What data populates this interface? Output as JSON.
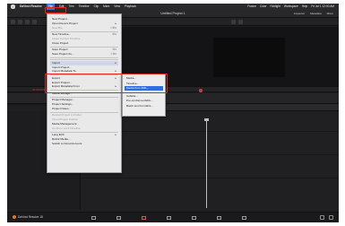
{
  "menubar": {
    "app_name": "DaVinci Resolve",
    "items": [
      "File",
      "Edit",
      "Trim",
      "Timeline",
      "Clip",
      "Mark",
      "View",
      "Playback"
    ],
    "active": "File",
    "right_items": [
      "Fusion",
      "Color",
      "Fairlight",
      "Workspace",
      "Help",
      "Fri Jul 1 12:00 AM"
    ]
  },
  "titlebar": {
    "project_title": "Untitled Project 1",
    "right_buttons": [
      "Inspector",
      "Metadata",
      "Mixer"
    ]
  },
  "file_menu": {
    "items": [
      {
        "label": "New Project...",
        "shortcut": "",
        "disabled": false,
        "submenu": false
      },
      {
        "label": "Open Recent Project",
        "shortcut": "",
        "disabled": false,
        "submenu": true
      },
      {
        "label": "New Bin",
        "shortcut": "⇧⌘N",
        "disabled": true,
        "submenu": false
      },
      {
        "label": "",
        "separator": true
      },
      {
        "label": "New Timeline...",
        "shortcut": "⌘N",
        "disabled": false,
        "submenu": false
      },
      {
        "label": "Close Current Timeline",
        "shortcut": "",
        "disabled": true,
        "submenu": false
      },
      {
        "label": "Close Project",
        "shortcut": "",
        "disabled": false,
        "submenu": false
      },
      {
        "label": "",
        "separator": true
      },
      {
        "label": "Save Project",
        "shortcut": "⌘S",
        "disabled": false,
        "submenu": false
      },
      {
        "label": "Save Project As...",
        "shortcut": "⇧⌘S",
        "disabled": false,
        "submenu": false
      },
      {
        "label": "",
        "separator": true
      },
      {
        "label": "",
        "separator": true
      },
      {
        "label": "Import",
        "shortcut": "",
        "disabled": false,
        "submenu": true,
        "highlight": true
      },
      {
        "label": "Import Project...",
        "shortcut": "",
        "disabled": false,
        "submenu": false
      },
      {
        "label": "Import Metadata To",
        "shortcut": "",
        "disabled": false,
        "submenu": true
      },
      {
        "label": "",
        "separator": true
      },
      {
        "label": "Export",
        "shortcut": "",
        "disabled": false,
        "submenu": true
      },
      {
        "label": "Export Project...",
        "shortcut": "",
        "disabled": false,
        "submenu": false
      },
      {
        "label": "Export Metadata From",
        "shortcut": "",
        "disabled": false,
        "submenu": true
      },
      {
        "label": "",
        "separator": true
      },
      {
        "label": "Media Storage...",
        "shortcut": "",
        "disabled": false,
        "submenu": false
      },
      {
        "label": "",
        "separator": true
      },
      {
        "label": "Project Manager...",
        "shortcut": "",
        "disabled": false,
        "submenu": false
      },
      {
        "label": "Project Settings...",
        "shortcut": "",
        "disabled": false,
        "submenu": false
      },
      {
        "label": "Project Notes...",
        "shortcut": "",
        "disabled": false,
        "submenu": false
      },
      {
        "label": "",
        "separator": true
      },
      {
        "label": "Reveal Project in Finder",
        "shortcut": "",
        "disabled": true,
        "submenu": false
      },
      {
        "label": "Open Project Archive",
        "shortcut": "",
        "disabled": true,
        "submenu": false
      },
      {
        "label": "Media Management...",
        "shortcut": "",
        "disabled": false,
        "submenu": false
      },
      {
        "label": "Conform Lock Timeline",
        "shortcut": "",
        "disabled": true,
        "submenu": false
      },
      {
        "label": "",
        "separator": true
      },
      {
        "label": "Lang ECF",
        "shortcut": "",
        "disabled": false,
        "submenu": true
      },
      {
        "label": "Relink Media...",
        "shortcut": "",
        "disabled": false,
        "submenu": false
      },
      {
        "label": "Switch to Cloud Account",
        "shortcut": "",
        "disabled": false,
        "submenu": false
      }
    ]
  },
  "import_submenu": {
    "items": [
      {
        "label": "Media...",
        "selected": false
      },
      {
        "label": "Timeline...",
        "selected": false
      },
      {
        "label": "Media from XML...",
        "selected": true
      },
      {
        "label": "",
        "separator": true
      },
      {
        "label": "Subtitle...",
        "selected": false
      },
      {
        "label": "Pre-conformed EDL...",
        "selected": false
      },
      {
        "label": "Batch List from EDL...",
        "selected": false
      }
    ]
  },
  "viewer": {
    "timecode": "00:00:00:00"
  },
  "pagebar": {
    "brand": "DaVinci Resolve 18",
    "pages": [
      "Media",
      "Cut",
      "Edit",
      "Fusion",
      "Color",
      "Fairlight",
      "Deliver"
    ],
    "active_page": "Edit"
  }
}
